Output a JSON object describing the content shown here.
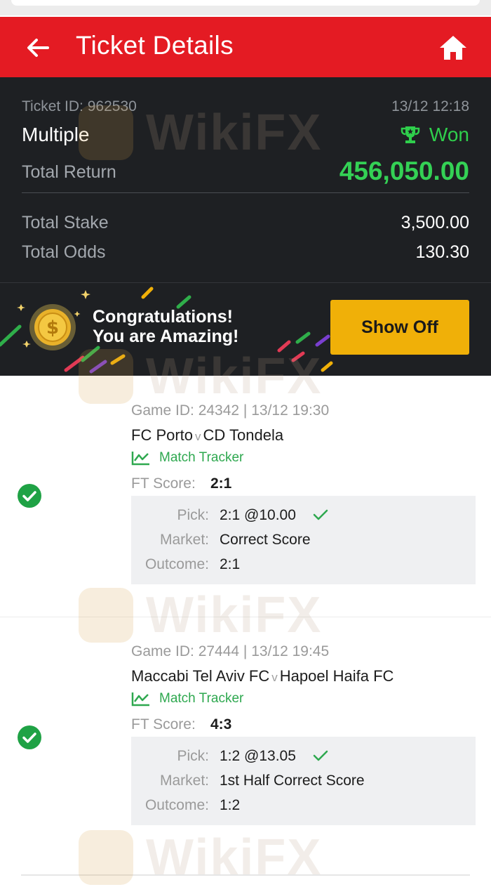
{
  "header": {
    "title": "Ticket Details",
    "back_icon": "arrow-left-icon",
    "home_icon": "home-icon",
    "bg_color": "#e41b23"
  },
  "summary": {
    "ticket_id": "Ticket ID: 962530",
    "datetime": "13/12 12:18",
    "bet_type": "Multiple",
    "status": "Won",
    "status_icon": "trophy-icon",
    "total_return_label": "Total Return",
    "total_return_value": "456,050.00",
    "total_stake_label": "Total Stake",
    "total_stake_value": "3,500.00",
    "total_odds_label": "Total Odds",
    "total_odds_value": "130.30",
    "win_color": "#2fcf4c"
  },
  "banner": {
    "line1": "Congratulations!",
    "line2": "You are Amazing!",
    "button_label": "Show Off",
    "coin_icon": "dollar-coin-icon",
    "button_color": "#f0b008"
  },
  "games": [
    {
      "meta": "Game ID: 24342 | 13/12 19:30",
      "home": "FC Porto",
      "vs": "v",
      "away": "CD Tondela",
      "tracker_label": "Match Tracker",
      "ft_label": "FT Score:",
      "ft_value": "2:1",
      "pick_label": "Pick:",
      "pick_value": "2:1 @10.00",
      "market_label": "Market:",
      "market_value": "Correct Score",
      "outcome_label": "Outcome:",
      "outcome_value": "2:1",
      "result_icon": "check-circle-icon"
    },
    {
      "meta": "Game ID: 27444 | 13/12 19:45",
      "home": "Maccabi Tel Aviv FC",
      "vs": "v",
      "away": "Hapoel Haifa FC",
      "tracker_label": "Match Tracker",
      "ft_label": "FT Score:",
      "ft_value": "4:3",
      "pick_label": "Pick:",
      "pick_value": "1:2 @13.05",
      "market_label": "Market:",
      "market_value": "1st Half Correct Score",
      "outcome_label": "Outcome:",
      "outcome_value": "1:2",
      "result_icon": "check-circle-icon"
    }
  ],
  "watermark": {
    "text": "WikiFX"
  }
}
